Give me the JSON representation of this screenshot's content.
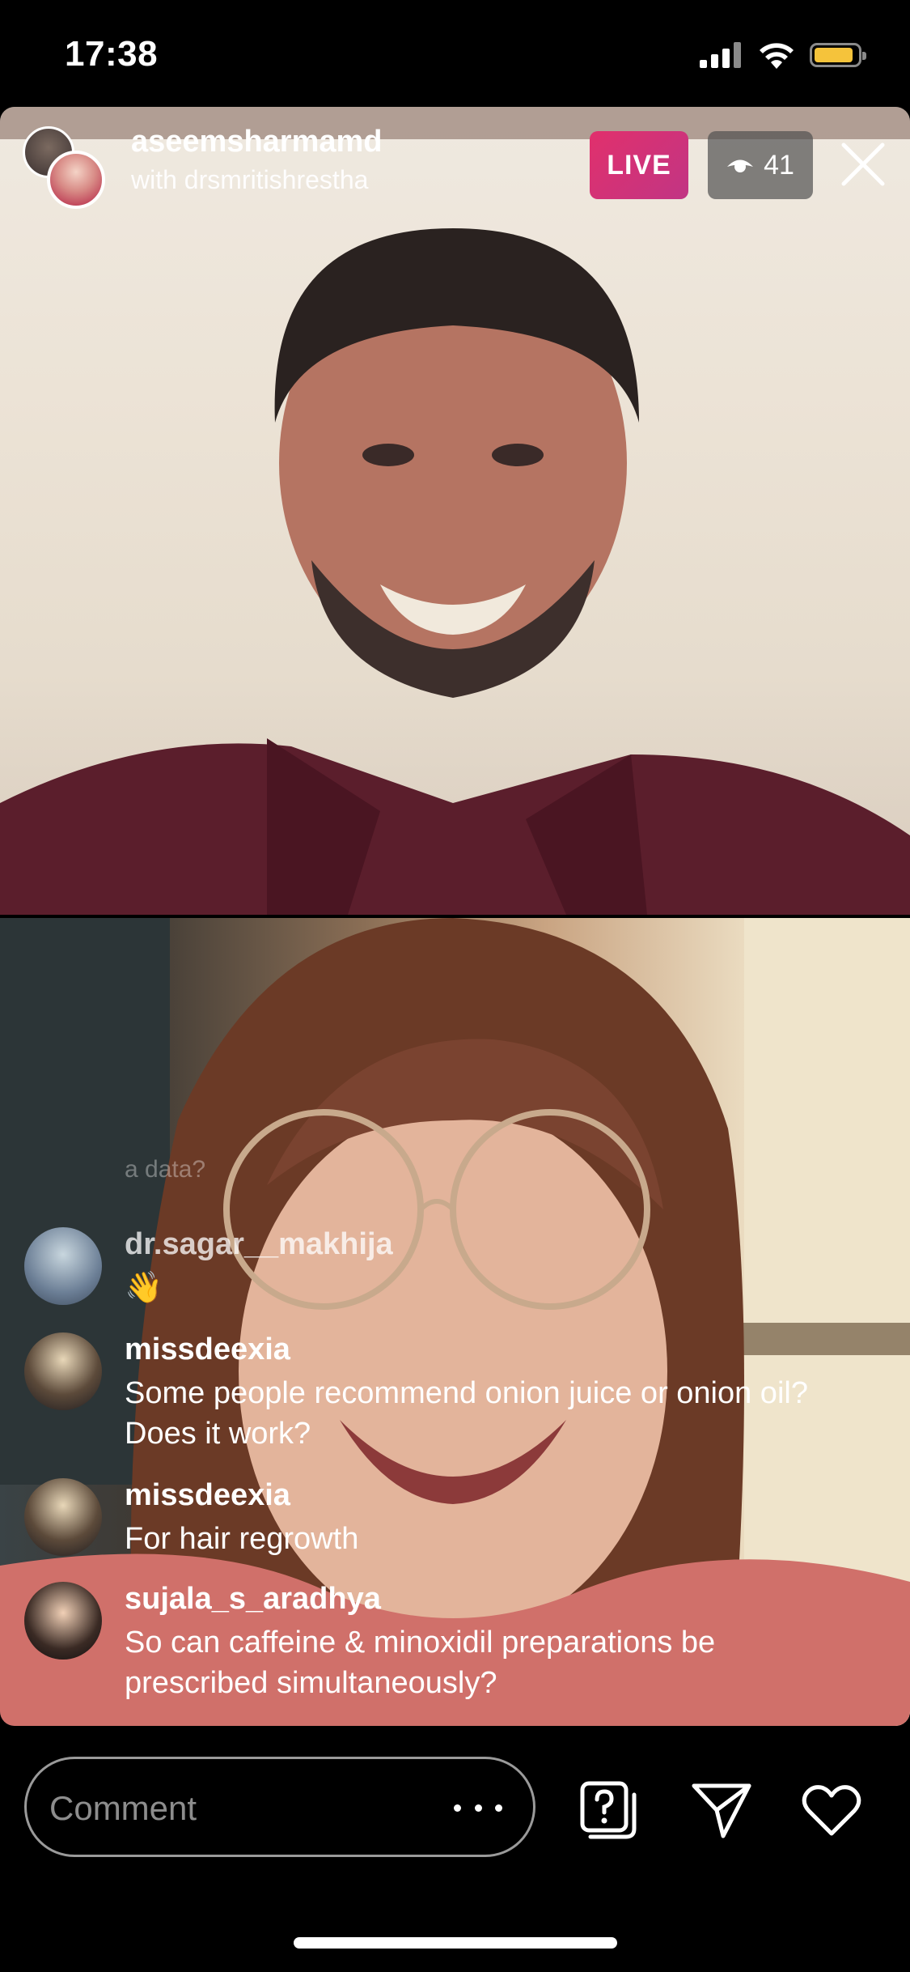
{
  "status_bar": {
    "time": "17:38"
  },
  "header": {
    "host": "aseemsharmamd",
    "with_text": "with drsmritishrestha",
    "live_label": "LIVE",
    "viewer_count": "41"
  },
  "comments": {
    "faded_text": "a data?",
    "items": [
      {
        "user": "dr.sagar__makhija",
        "text": "👋"
      },
      {
        "user": "missdeexia",
        "text": "Some people recommend onion juice or onion oil? Does it work?"
      },
      {
        "user": "missdeexia",
        "text": "For hair regrowth"
      },
      {
        "user": "sujala_s_aradhya",
        "text": "So can caffeine & minoxidil preparations be prescribed simultaneously?"
      }
    ]
  },
  "bottom_bar": {
    "comment_placeholder": "Comment"
  },
  "icons": [
    "signal-icon",
    "wifi-icon",
    "battery-icon",
    "eye-icon",
    "close-icon",
    "more-icon",
    "question-icon",
    "send-icon",
    "heart-icon"
  ],
  "colors": {
    "live_gradient_start": "#e1306c",
    "live_gradient_end": "#c13584",
    "battery": "#f5c33b"
  }
}
